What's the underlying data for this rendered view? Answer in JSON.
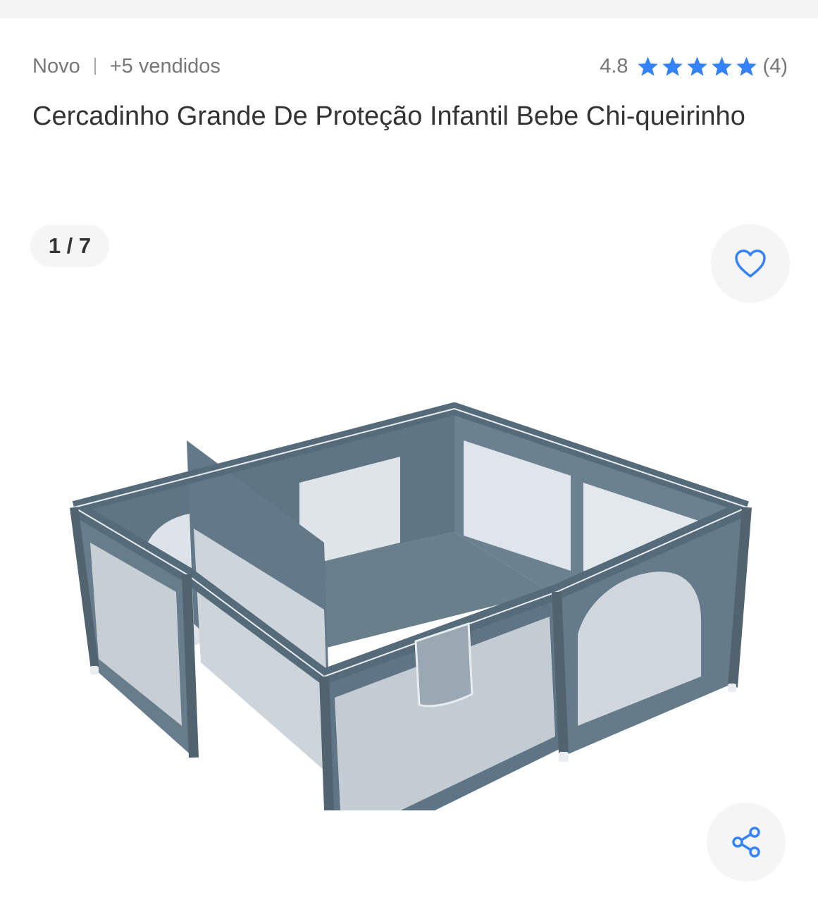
{
  "header": {
    "condition": "Novo",
    "sold": "+5 vendidos",
    "rating": "4.8",
    "stars": 5,
    "review_count": "(4)",
    "star_color": "#3483fa"
  },
  "product": {
    "title": "Cercadinho Grande De Proteção Infantil Bebe Chi-queirinho"
  },
  "gallery": {
    "counter": "1 / 7",
    "image_subject": "playpen-image",
    "accent_color": "#3483fa"
  }
}
